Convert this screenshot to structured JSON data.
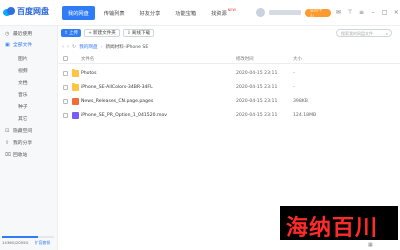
{
  "app": {
    "logo_text": "百度网盘"
  },
  "nav": {
    "tabs": [
      {
        "label": "我的网盘"
      },
      {
        "label": "传输列表"
      },
      {
        "label": "好友分享"
      },
      {
        "label": "功能宝箱"
      },
      {
        "label": "找资源"
      }
    ],
    "new_badge": "NEW"
  },
  "user": {
    "member_button": "会员中心"
  },
  "sidebar": {
    "items": [
      {
        "label": "最近使用"
      },
      {
        "label": "全部文件"
      },
      {
        "label": "图片"
      },
      {
        "label": "视频"
      },
      {
        "label": "文档"
      },
      {
        "label": "音乐"
      },
      {
        "label": "种子"
      },
      {
        "label": "其它"
      },
      {
        "label": "隐藏空间"
      },
      {
        "label": "我的分享"
      },
      {
        "label": "回收站"
      }
    ],
    "storage_text": "1436G/2055G",
    "storage_fraction": 0.7,
    "expand_link": "扩容套餐"
  },
  "toolbar": {
    "upload": "上传",
    "new_folder": "新建文件夹",
    "offline_download": "离线下载",
    "search_placeholder": "搜索我的网盘文件"
  },
  "breadcrumb": {
    "root": "我的网盘",
    "current": "新闻材料-iPhone SE"
  },
  "list": {
    "headers": {
      "name": "文件名",
      "date": "修改时间",
      "size": "大小"
    },
    "rows": [
      {
        "name": "Photos",
        "date": "2020-04-15 23:11",
        "size": "-",
        "type": "folder"
      },
      {
        "name": "iPhone_SE-AllColors-34BR-34FL",
        "date": "2020-04-15 23:11",
        "size": "-",
        "type": "folder"
      },
      {
        "name": "News_Releases_CN.page.pages",
        "date": "2020-04-15 23:11",
        "size": "398KB",
        "type": "doc"
      },
      {
        "name": "iPhone_SE_PR_Option_1_041520.mov",
        "date": "2020-04-15 23:11",
        "size": "124.18MB",
        "type": "video"
      }
    ]
  },
  "watermark": {
    "text": "海纳百川"
  }
}
